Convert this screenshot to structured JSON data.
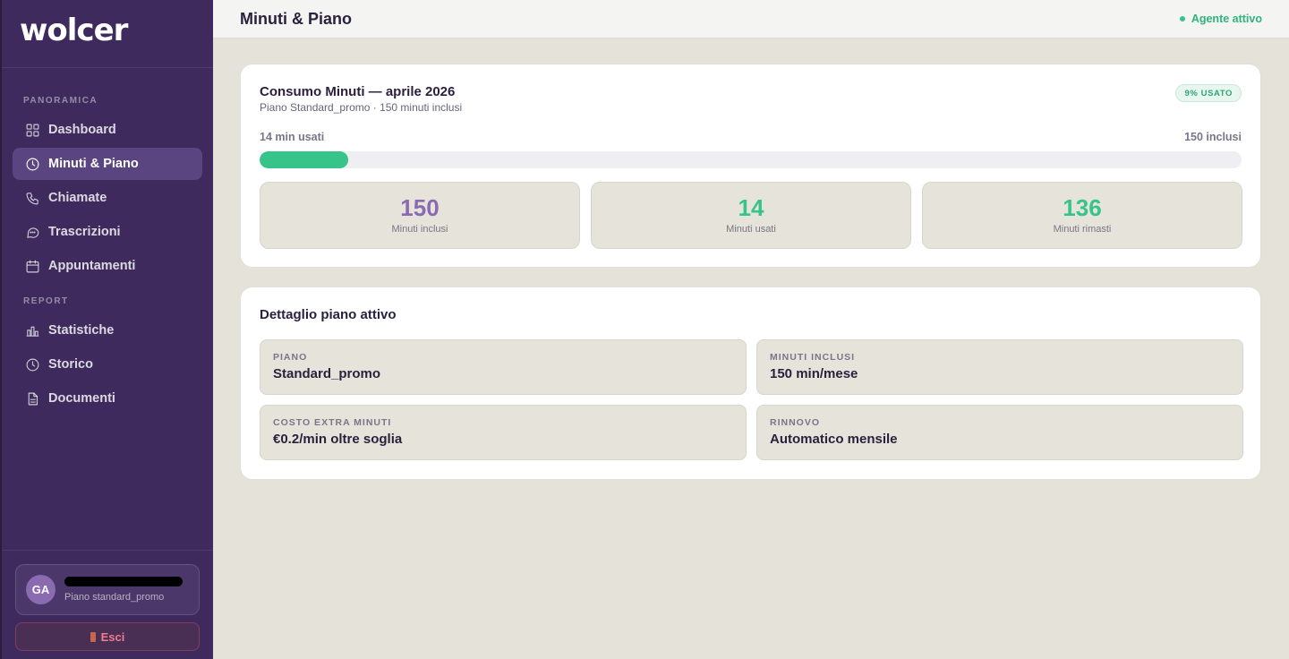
{
  "brand": {
    "logo_text": "wolcer"
  },
  "sidebar": {
    "sections": [
      {
        "label": "PANORAMICA"
      },
      {
        "label": "REPORT"
      }
    ],
    "items": [
      {
        "label": "Dashboard",
        "icon": "grid-icon",
        "active": false
      },
      {
        "label": "Minuti & Piano",
        "icon": "clock-icon",
        "active": true
      },
      {
        "label": "Chiamate",
        "icon": "phone-icon",
        "active": false
      },
      {
        "label": "Trascrizioni",
        "icon": "chat-bubble-icon",
        "active": false
      },
      {
        "label": "Appuntamenti",
        "icon": "calendar-icon",
        "active": false
      },
      {
        "label": "Statistiche",
        "icon": "bar-chart-icon",
        "active": false
      },
      {
        "label": "Storico",
        "icon": "history-clock-icon",
        "active": false
      },
      {
        "label": "Documenti",
        "icon": "document-icon",
        "active": false
      }
    ],
    "user": {
      "initials": "GA",
      "plan": "Piano standard_promo"
    },
    "logout_label": "Esci"
  },
  "header": {
    "title": "Minuti & Piano",
    "agent_status": "Agente attivo"
  },
  "usage": {
    "title": "Consumo Minuti — aprile 2026",
    "subtitle": "Piano Standard_promo · 150 minuti inclusi",
    "badge": "9% USATO",
    "used_label": "14 min usati",
    "included_label": "150 inclusi",
    "progress_fraction": 0.09,
    "stats": [
      {
        "value": "150",
        "label": "Minuti inclusi"
      },
      {
        "value": "14",
        "label": "Minuti usati"
      },
      {
        "value": "136",
        "label": "Minuti rimasti"
      }
    ]
  },
  "detail": {
    "title": "Dettaglio piano attivo",
    "fields": [
      {
        "label": "PIANO",
        "value": "Standard_promo"
      },
      {
        "label": "MINUTI INCLUSI",
        "value": "150 min/mese"
      },
      {
        "label": "COSTO EXTRA MINUTI",
        "value": "€0.2/min oltre soglia"
      },
      {
        "label": "RINNOVO",
        "value": "Automatico mensile"
      }
    ]
  },
  "colors": {
    "sidebar_bg": "#3e2a5c",
    "accent_green": "#36c48a",
    "accent_purple": "#8a6ab0",
    "page_bg": "#e5e2d9"
  }
}
